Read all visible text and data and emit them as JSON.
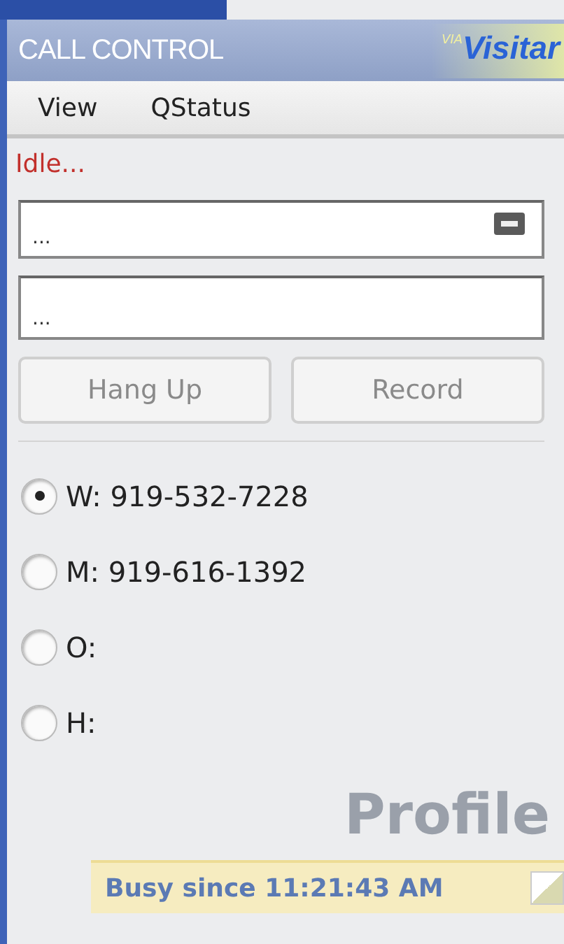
{
  "header": {
    "title": "CALL CONTROL",
    "logo_prefix": "VIA",
    "logo": "Visitar"
  },
  "menu": [
    {
      "label": "View"
    },
    {
      "label": "QStatus"
    }
  ],
  "status": "Idle...",
  "fields": [
    {
      "value": "...",
      "kind": "minimizable"
    },
    {
      "value": "...",
      "kind": "plain"
    }
  ],
  "buttons": [
    {
      "label": "Hang Up",
      "disabled": true
    },
    {
      "label": "Record",
      "disabled": true
    }
  ],
  "phones": [
    {
      "label": "W: 919-532-7228",
      "selected": true
    },
    {
      "label": "M: 919-616-1392",
      "selected": false
    },
    {
      "label": "O:",
      "selected": false
    },
    {
      "label": "H:",
      "selected": false
    }
  ],
  "watermark": "Profile",
  "status_bar": {
    "text": "Busy since 11:21:43 AM"
  }
}
